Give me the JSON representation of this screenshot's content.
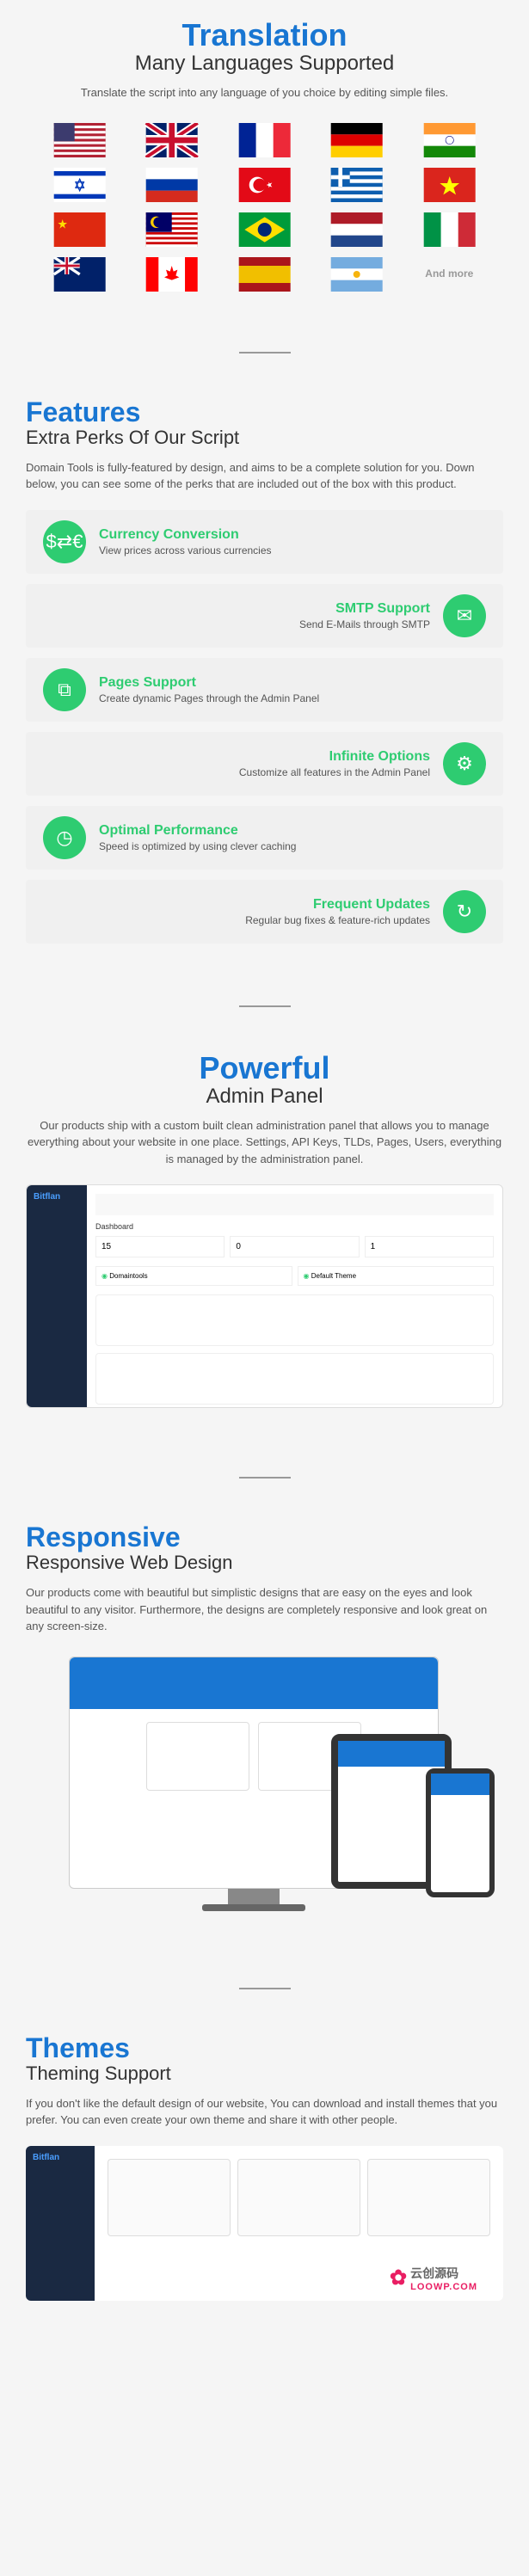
{
  "translation": {
    "title": "Translation",
    "subtitle": "Many Languages Supported",
    "desc": "Translate the script into any language of you choice by editing simple files.",
    "more": "And more"
  },
  "features": {
    "title": "Features",
    "subtitle": "Extra Perks Of Our Script",
    "desc": "Domain Tools is fully-featured by design, and aims to be a complete solution for you. Down below, you can see some of the perks that are included out of the box with this product.",
    "items": [
      {
        "title": "Currency Conversion",
        "desc": "View prices across various currencies"
      },
      {
        "title": "SMTP Support",
        "desc": "Send E-Mails through SMTP"
      },
      {
        "title": "Pages Support",
        "desc": "Create dynamic Pages through the Admin Panel"
      },
      {
        "title": "Infinite Options",
        "desc": "Customize all features in the Admin Panel"
      },
      {
        "title": "Optimal Performance",
        "desc": "Speed is optimized by using clever caching"
      },
      {
        "title": "Frequent Updates",
        "desc": "Regular bug fixes & feature-rich updates"
      }
    ]
  },
  "powerful": {
    "title": "Powerful",
    "subtitle": "Admin Panel",
    "desc": "Our products ship with a custom built clean administration panel that allows you to manage everything about your website in one place. Settings, API Keys, TLDs, Pages, Users, everything is managed by the administration panel.",
    "dashboard_label": "Dashboard",
    "domaintools_label": "Domaintools",
    "theme_label": "Default Theme",
    "stats": {
      "a": "15",
      "b": "0",
      "c": "1"
    }
  },
  "responsive": {
    "title": "Responsive",
    "subtitle": "Responsive Web Design",
    "desc": "Our products come with beautiful but simplistic designs that are easy on the eyes and look beautiful to any visitor. Furthermore, the designs are completely responsive and look great on any screen-size."
  },
  "themes": {
    "title": "Themes",
    "subtitle": "Theming Support",
    "desc": "If you don't like the default design of our website, You can download and install themes that you prefer. You can even create your own theme and share it with other people."
  },
  "watermark": {
    "brand": "云创源码",
    "url": "LOOWP.COM"
  }
}
